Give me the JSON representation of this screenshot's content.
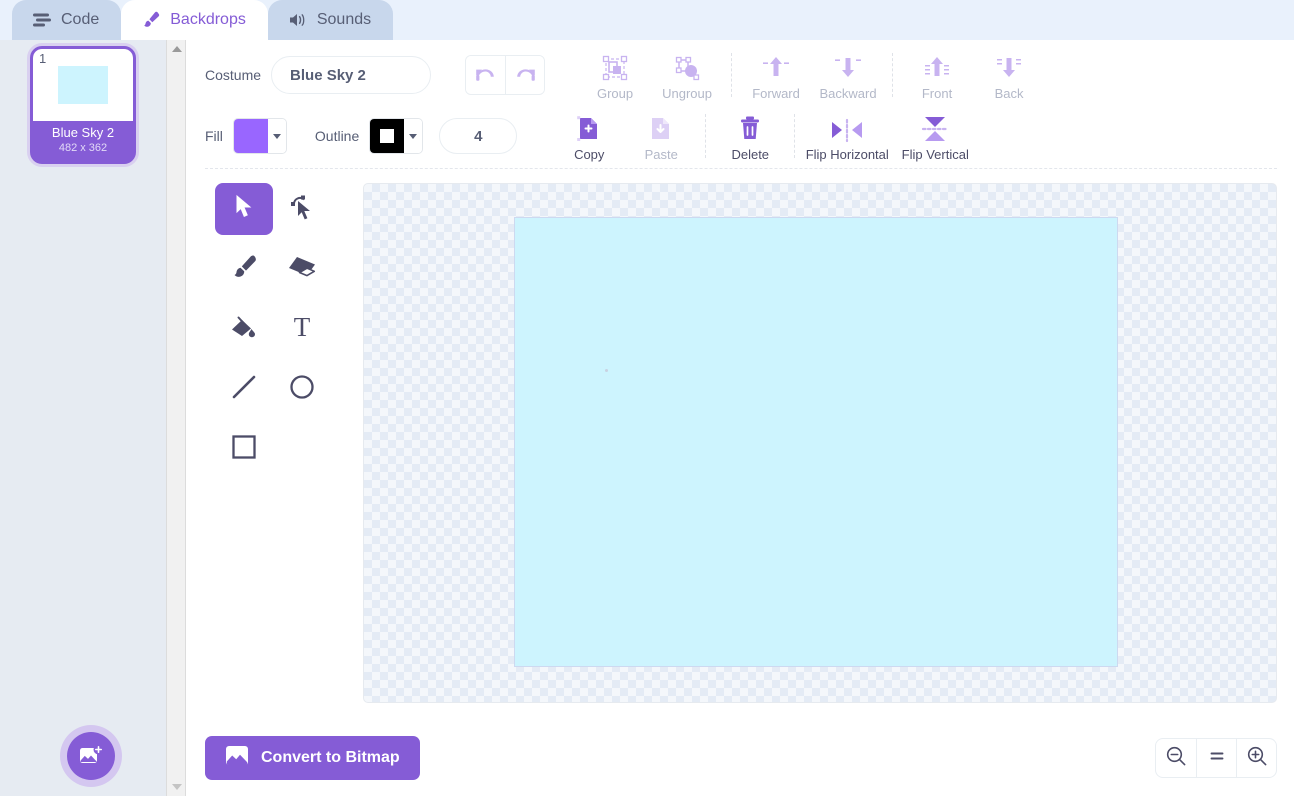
{
  "tabs": [
    {
      "label": "Code",
      "icon": "code-icon",
      "active": false
    },
    {
      "label": "Backdrops",
      "icon": "paintbrush-icon",
      "active": true
    },
    {
      "label": "Sounds",
      "icon": "speaker-icon",
      "active": false
    }
  ],
  "sidebar": {
    "backdrops": [
      {
        "index": "1",
        "name": "Blue Sky 2",
        "size": "482 x 362",
        "selected": true
      }
    ],
    "add_button": "add-backdrop-button"
  },
  "toolbar": {
    "costume_label": "Costume",
    "costume_value": "Blue Sky 2",
    "costume_placeholder": "Costume name",
    "undo_label": "undo",
    "redo_label": "redo",
    "fill_label": "Fill",
    "fill_color": "#9966FF",
    "outline_label": "Outline",
    "outline_color": "#000000",
    "stroke_width": "4",
    "actions_row1": [
      {
        "label": "Group",
        "disabled": true
      },
      {
        "label": "Ungroup",
        "disabled": true
      },
      {
        "label": "Forward",
        "disabled": true
      },
      {
        "label": "Backward",
        "disabled": true
      },
      {
        "label": "Front",
        "disabled": true
      },
      {
        "label": "Back",
        "disabled": true
      }
    ],
    "actions_row2": [
      {
        "label": "Copy",
        "disabled": false
      },
      {
        "label": "Paste",
        "disabled": true
      },
      {
        "label": "Delete",
        "disabled": false
      },
      {
        "label": "Flip Horizontal",
        "disabled": false
      },
      {
        "label": "Flip Vertical",
        "disabled": false
      }
    ]
  },
  "tools": [
    {
      "name": "select-tool",
      "active": true
    },
    {
      "name": "reshape-tool",
      "active": false
    },
    {
      "name": "brush-tool",
      "active": false
    },
    {
      "name": "eraser-tool",
      "active": false
    },
    {
      "name": "fill-tool",
      "active": false
    },
    {
      "name": "text-tool",
      "active": false
    },
    {
      "name": "line-tool",
      "active": false
    },
    {
      "name": "circle-tool",
      "active": false
    },
    {
      "name": "rectangle-tool",
      "active": false
    }
  ],
  "canvas": {
    "artwork_color": "#CDF4FE",
    "background": "transparent-checkerboard"
  },
  "bottom": {
    "convert_label": "Convert to Bitmap",
    "zoom_out_label": "zoom-out",
    "zoom_reset_label": "=",
    "zoom_in_label": "zoom-in"
  },
  "colors": {
    "accent": "#855CD6",
    "tab_bar": "#E9F1FC",
    "sidebar": "#E6EBF2",
    "text": "#575E75"
  }
}
